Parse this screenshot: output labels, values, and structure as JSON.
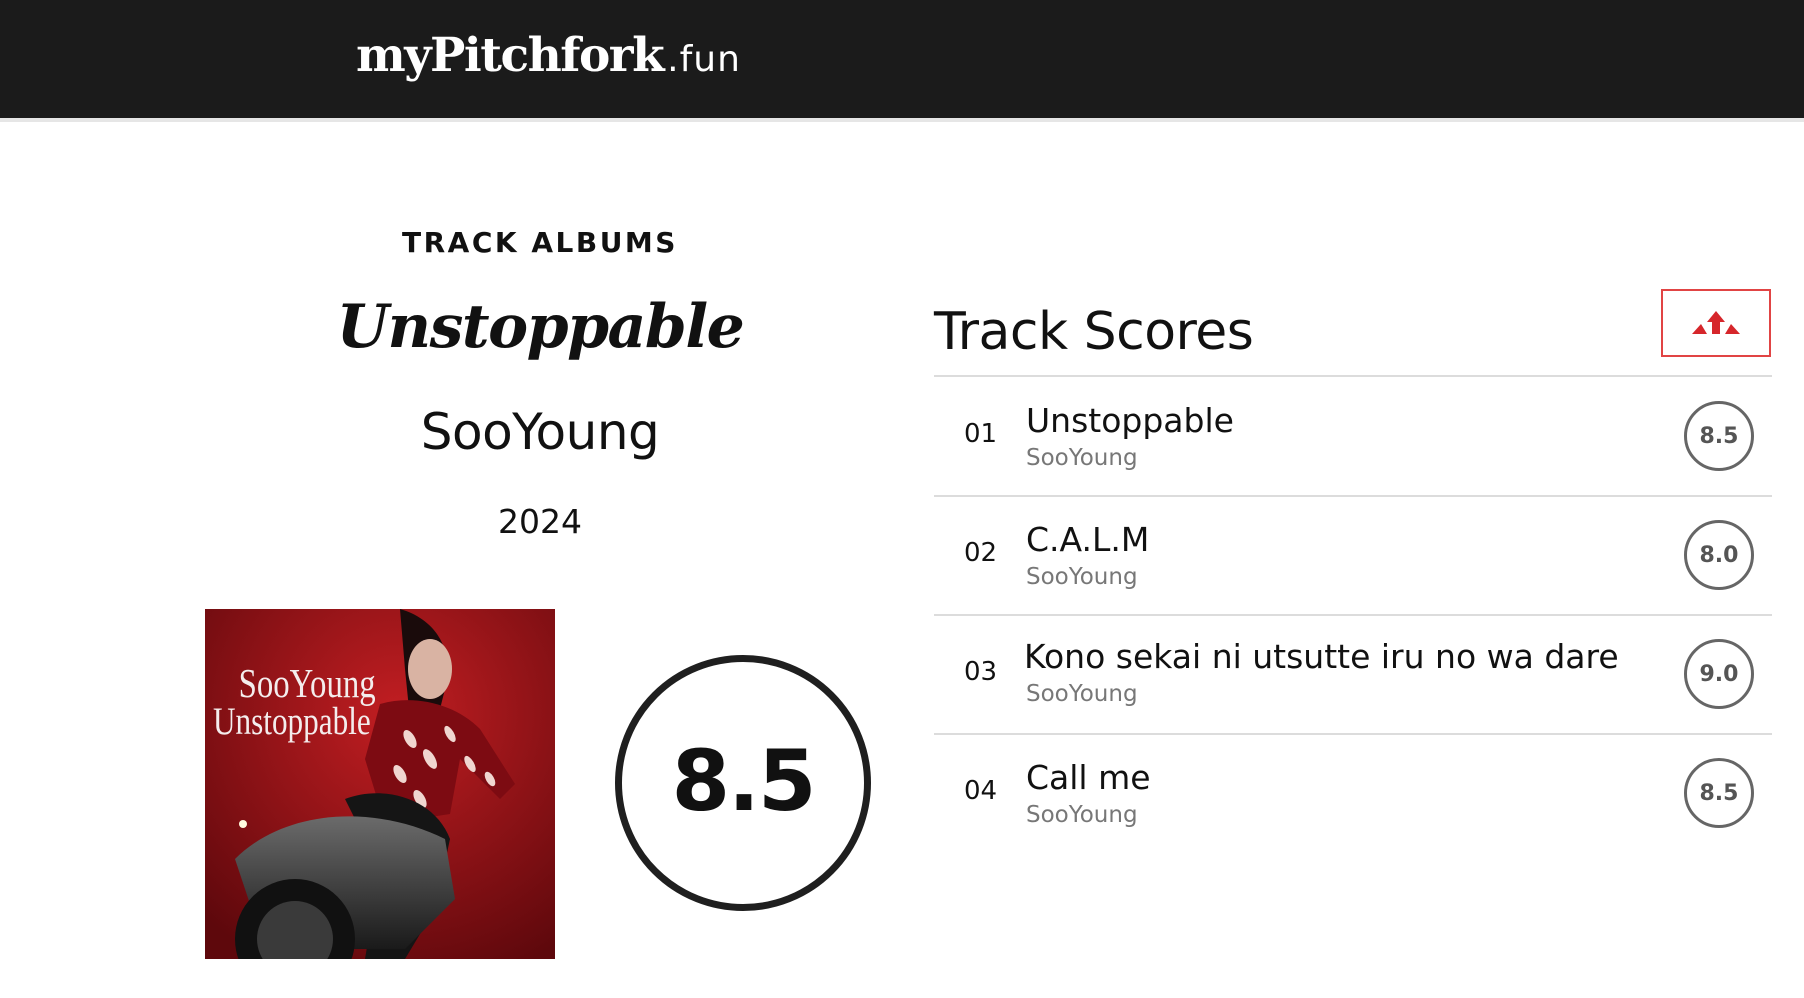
{
  "site": {
    "logo_main": "myPitchfork",
    "logo_sub": ".fun"
  },
  "album": {
    "kicker": "TRACK ALBUMS",
    "title": "Unstoppable",
    "artist": "SooYoung",
    "year": "2024",
    "score": "8.5",
    "cover": {
      "line1": "SooYoung",
      "line2": "Unstoppable",
      "accent_color": "#8d1015"
    }
  },
  "track_scores": {
    "heading": "Track Scores",
    "sort_icon": "sort-ascending-icon",
    "accent_color": "#e14444",
    "tracks": [
      {
        "num": "01",
        "title": "Unstoppable",
        "artist": "SooYoung",
        "score": "8.5"
      },
      {
        "num": "02",
        "title": "C.A.L.M",
        "artist": "SooYoung",
        "score": "8.0"
      },
      {
        "num": "03",
        "title": "Kono sekai ni utsutte iru no wa dare",
        "artist": "SooYoung",
        "score": "9.0"
      },
      {
        "num": "04",
        "title": "Call me",
        "artist": "SooYoung",
        "score": "8.5"
      }
    ]
  }
}
